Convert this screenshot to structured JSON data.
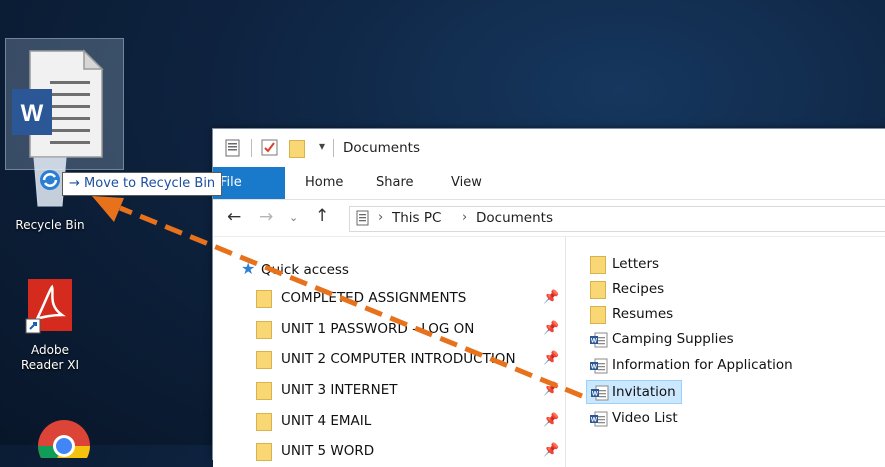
{
  "desktop": {
    "recycle_bin_label": "Recycle Bin",
    "adobe_label_line1": "Adobe",
    "adobe_label_line2": "Reader XI"
  },
  "drag_tooltip": {
    "arrow": "→",
    "text": "Move to Recycle Bin"
  },
  "explorer": {
    "title": "Documents",
    "ribbon_tabs": [
      "File",
      "Home",
      "Share",
      "View"
    ],
    "breadcrumb": [
      "This PC",
      "Documents"
    ],
    "nav": {
      "quick_access": "Quick access",
      "items": [
        "COMPLETED ASSIGNMENTS",
        "UNIT 1 PASSWORD - LOG ON",
        "UNIT 2 COMPUTER INTRODUCTION",
        "UNIT 3 INTERNET",
        "UNIT 4 EMAIL",
        "UNIT 5 WORD"
      ]
    },
    "content": {
      "folders": [
        "Letters",
        "Recipes",
        "Resumes"
      ],
      "documents": [
        "Camping Supplies",
        "Information for Application",
        "Invitation",
        "Video List"
      ],
      "selected": "Invitation"
    }
  },
  "colors": {
    "accent_blue": "#1979ca",
    "drag_arrow": "#e8711b",
    "selection": "#cce8ff"
  }
}
